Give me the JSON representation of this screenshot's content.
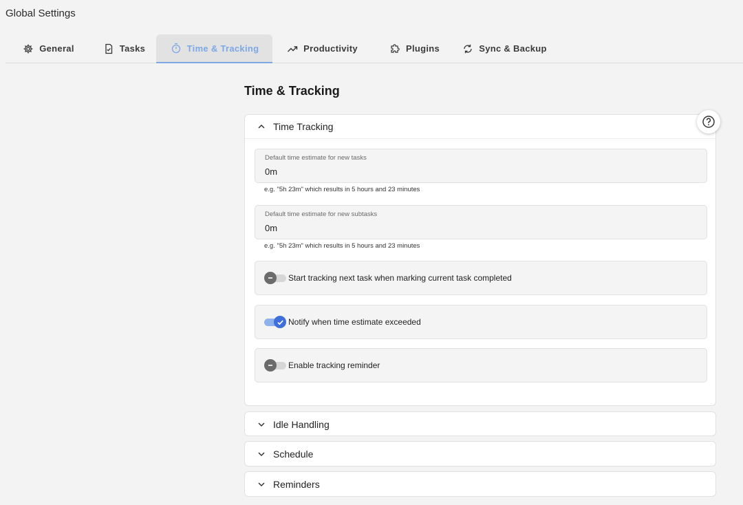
{
  "window": {
    "title": "Global Settings"
  },
  "tabs": [
    {
      "label": "General",
      "icon": "gear-icon"
    },
    {
      "label": "Tasks",
      "icon": "task-check-icon"
    },
    {
      "label": "Time & Tracking",
      "icon": "timer-icon",
      "active": true
    },
    {
      "label": "Productivity",
      "icon": "trending-up-icon"
    },
    {
      "label": "Plugins",
      "icon": "puzzle-icon"
    },
    {
      "label": "Sync & Backup",
      "icon": "sync-icon"
    }
  ],
  "main": {
    "title": "Time & Tracking",
    "time_tracking": {
      "header": "Time Tracking",
      "expanded": true,
      "task_estimate": {
        "label": "Default time estimate for new tasks",
        "value": "0m",
        "hint": "e.g. \"5h 23m\" which results in 5 hours and 23 minutes"
      },
      "subtask_estimate": {
        "label": "Default time estimate for new subtasks",
        "value": "0m",
        "hint": "e.g. \"5h 23m\" which results in 5 hours and 23 minutes"
      },
      "toggles": [
        {
          "label": "Start tracking next task when marking current task completed",
          "checked": false
        },
        {
          "label": "Notify when time estimate exceeded",
          "checked": true
        },
        {
          "label": "Enable tracking reminder",
          "checked": false
        }
      ]
    },
    "idle_handling": {
      "header": "Idle Handling"
    },
    "schedule": {
      "header": "Schedule"
    },
    "reminders": {
      "header": "Reminders"
    }
  },
  "help": {
    "icon": "help-icon"
  },
  "colors": {
    "accent": "#7da7e6",
    "toggle_on": "#3f6fd8",
    "toggle_off": "#6b6b6b"
  }
}
